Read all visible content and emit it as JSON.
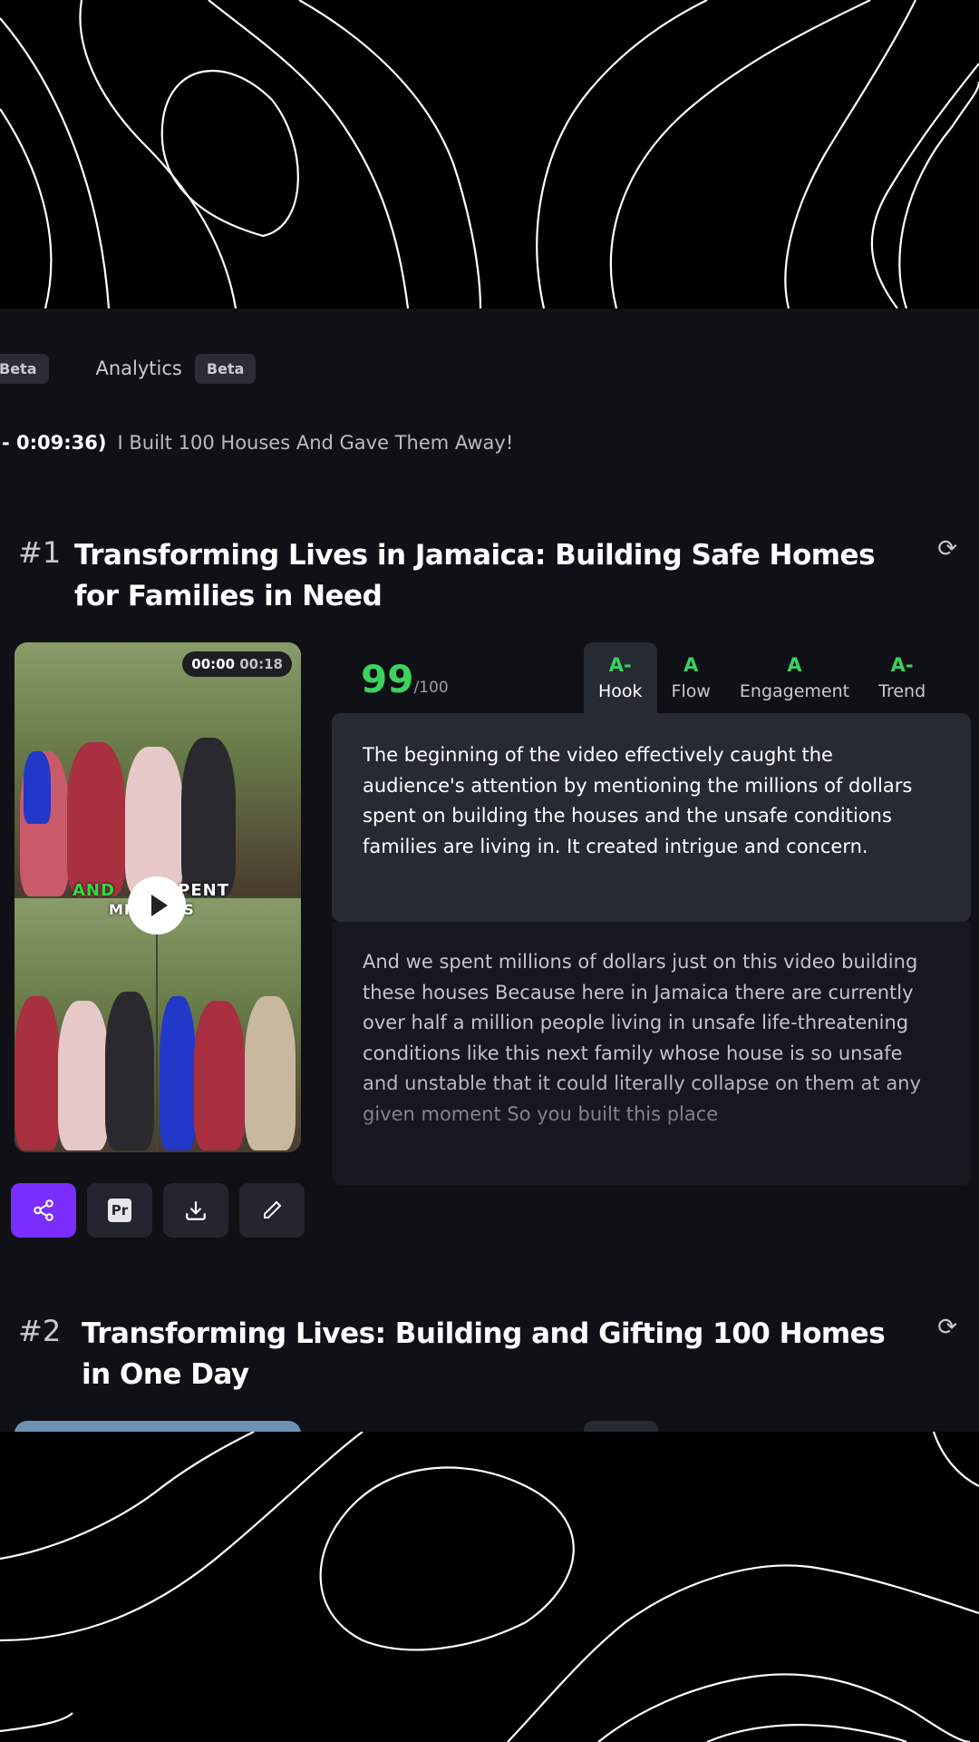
{
  "nav": {
    "partial_badge": "Beta",
    "analytics_label": "Analytics",
    "analytics_badge": "Beta"
  },
  "source": {
    "timestamp": "- 0:09:36)",
    "video_title": "I Built 100 Houses And Gave Them Away!"
  },
  "clips": [
    {
      "rank": "#1",
      "title": "Transforming Lives in Jamaica: Building Safe Homes for Families in Need",
      "thumbnail": {
        "time_current": "00:00",
        "time_total": "00:18",
        "caption_highlight": "AND",
        "caption_rest": "SPENT",
        "caption_line2": "MILLIONS"
      },
      "score": "99",
      "score_max": "/100",
      "tabs": [
        {
          "grade": "A-",
          "name": "Hook"
        },
        {
          "grade": "A",
          "name": "Flow"
        },
        {
          "grade": "A",
          "name": "Engagement"
        },
        {
          "grade": "A-",
          "name": "Trend"
        }
      ],
      "analysis": "The beginning of the video effectively caught the audience's attention by mentioning the millions of dollars spent on building the houses and the unsafe conditions families are living in. It created intrigue and concern.",
      "transcript": "And we spent millions of dollars just on this video building these houses Because here in Jamaica there are currently over half a million people living in unsafe life-threatening conditions like this next family whose house is so unsafe and unstable that it could literally collapse on them at any given moment So you built this place",
      "actions": {
        "share_icon": "share-icon",
        "premiere_label": "Pr",
        "download_icon": "download-icon",
        "edit_icon": "pencil-icon"
      }
    },
    {
      "rank": "#2",
      "title": "Transforming Lives: Building and Gifting 100 Homes in One Day"
    }
  ],
  "colors": {
    "accent": "#7a2dff",
    "grade_green": "#3dd15f",
    "panel_bg": "#0f1116"
  }
}
